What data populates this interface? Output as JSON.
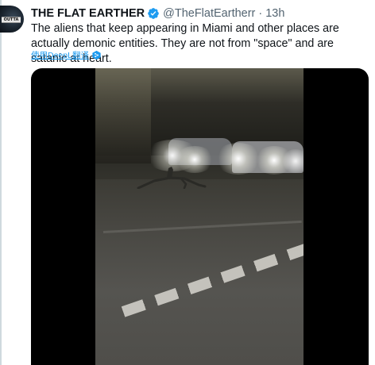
{
  "tweet": {
    "display_name": "THE FLAT EARTHER",
    "handle": "@TheFlatEartherr",
    "separator": "·",
    "time": "13h",
    "text": "The aliens that keep appearing in Miami and other places are actually demonic entities. They are not from \"space\" and are satanic at heart.",
    "translate_label": "使用DeepL翻译"
  },
  "avatar": {
    "badge_text": "OUTTA"
  },
  "icons": {
    "verified": "verified-badge-icon",
    "translate": "deepl-translate-icon"
  },
  "colors": {
    "accent": "#1d9bf0",
    "text_primary": "#0f1419",
    "text_secondary": "#536471"
  }
}
